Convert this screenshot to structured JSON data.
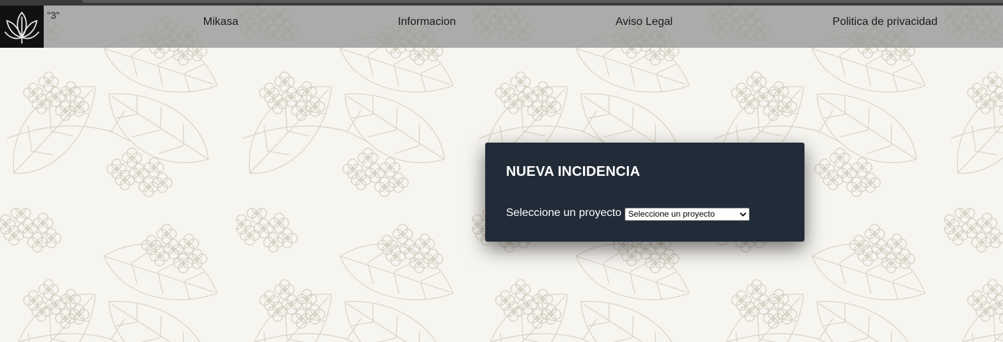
{
  "header": {
    "logo_icon": "lotus-leaf-icon",
    "badge_text": "\"3\"",
    "nav": [
      {
        "label": "Mikasa"
      },
      {
        "label": "Informacion"
      },
      {
        "label": "Aviso Legal"
      },
      {
        "label": "Politica de privacidad"
      }
    ]
  },
  "modal": {
    "title": "NUEVA INCIDENCIA",
    "field_label": "Seleccione un proyecto",
    "select": {
      "value": "Seleccione un proyecto",
      "icon": "chevron-down-icon"
    }
  },
  "background": {
    "pattern": "floral-line-art",
    "colors": {
      "base": "#f7f5f0",
      "line": "#d6d0c2",
      "navbar": "#969696",
      "modal": "#222b38"
    }
  }
}
